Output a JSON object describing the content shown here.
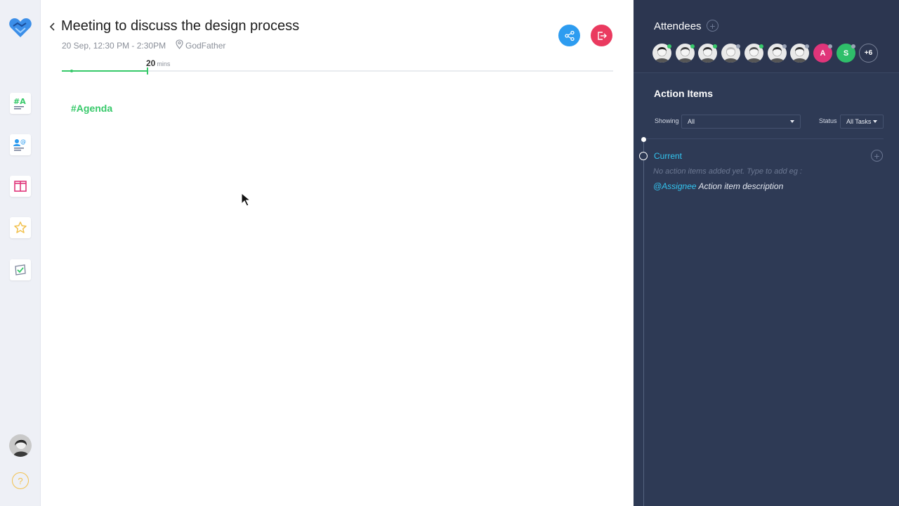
{
  "meeting": {
    "title": "Meeting to discuss the design process",
    "time": "20 Sep, 12:30 PM - 2:30PM",
    "location": "GodFather",
    "duration_value": "20",
    "duration_unit": "mins",
    "elapsed_fraction": 0.155
  },
  "agenda_label": "#Agenda",
  "sidebar": {
    "items": [
      {
        "name": "agenda-icon",
        "glyph": "#A"
      },
      {
        "name": "mentions-icon"
      },
      {
        "name": "layout-icon"
      },
      {
        "name": "star-icon"
      },
      {
        "name": "notes-icon"
      }
    ],
    "help_glyph": "?"
  },
  "attendees": {
    "title": "Attendees",
    "letters": [
      {
        "letter": "A",
        "color": "#e0357a"
      },
      {
        "letter": "S",
        "color": "#2fbf6a"
      }
    ],
    "more": "+6",
    "status_colors": [
      "#37c96a",
      "#37c96a",
      "#37c96a",
      "#9aa3b5",
      "#37c96a",
      "#9aa3b5",
      "#9aa3b5",
      "#9aa3b5",
      "#9aa3b5"
    ]
  },
  "action_items": {
    "title": "Action Items",
    "showing_label": "Showing",
    "showing_value": "All",
    "status_label": "Status",
    "status_value": "All Tasks",
    "section": "Current",
    "empty_hint": "No action items added yet. Type to add eg :",
    "example_assignee": "@Assignee",
    "example_desc": "Action item description"
  },
  "colors": {
    "accent_green": "#37c96a",
    "share": "#2d9cf0",
    "exit": "#ea3a5f",
    "panel": "#2e3a55",
    "link_blue": "#33c5f0"
  }
}
